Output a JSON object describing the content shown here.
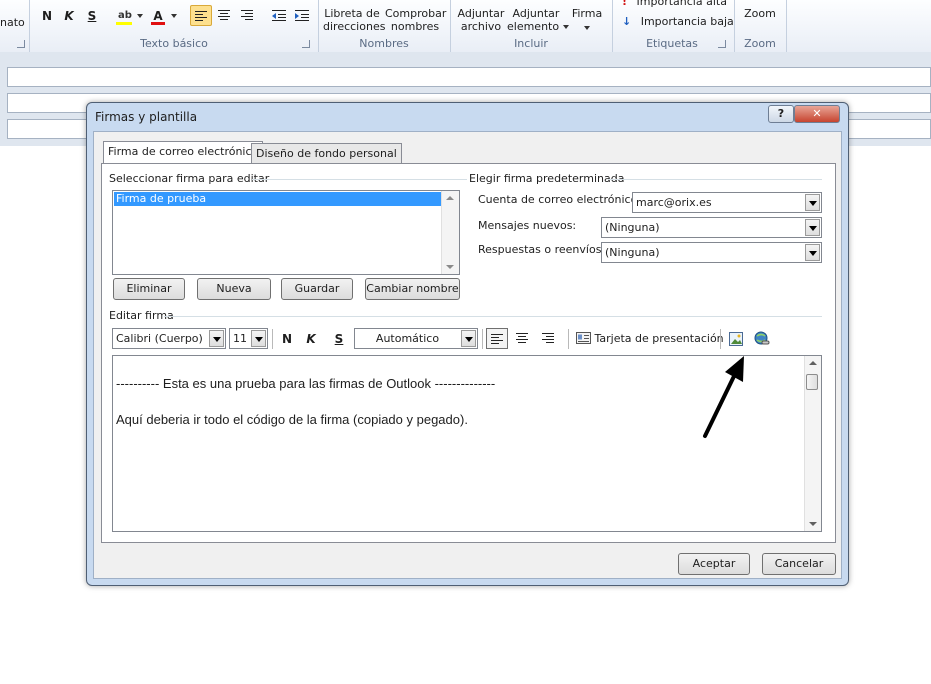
{
  "ribbon": {
    "formato_partial": "nato",
    "texto_basico": "Texto básico",
    "nombres_group": "Nombres",
    "incluir_group": "Incluir",
    "etiquetas_group": "Etiquetas",
    "zoom_group": "Zoom",
    "bold": "N",
    "italic": "K",
    "underline": "S",
    "highlight_glyph": "ab",
    "fontcolor_glyph": "A",
    "libreta_line1": "Libreta de",
    "libreta_line2": "direcciones",
    "comprobar_line1": "Comprobar",
    "comprobar_line2": "nombres",
    "adjuntar_archivo_line1": "Adjuntar",
    "adjuntar_archivo_line2": "archivo",
    "adjuntar_elemento_line1": "Adjuntar",
    "adjuntar_elemento_line2": "elemento",
    "firma": "Firma",
    "importancia_alta": "Importancia alta",
    "importancia_baja": "Importancia baja",
    "zoom": "Zoom"
  },
  "dialog": {
    "title": "Firmas y plantilla",
    "help_glyph": "?",
    "close_glyph": "✕",
    "tabs": [
      {
        "label": "Firma de correo electrónico"
      },
      {
        "label": "Diseño de fondo personal"
      }
    ],
    "select_section": "Seleccionar firma para editar",
    "signatures": [
      "Firma de prueba"
    ],
    "buttons": {
      "eliminar": "Eliminar",
      "nueva": "Nueva",
      "guardar": "Guardar",
      "cambiar_nombre": "Cambiar nombre"
    },
    "default_section": "Elegir firma predeterminada",
    "cuenta_label": "Cuenta de correo electrónico:",
    "cuenta_value": "marc@orix.es",
    "mensajes_label": "Mensajes nuevos:",
    "mensajes_value": "(Ninguna)",
    "respuestas_label": "Respuestas o reenvíos:",
    "respuestas_value": "(Ninguna)",
    "edit_section": "Editar firma",
    "font_value": "Calibri (Cuerpo)",
    "size_value": "11",
    "bold": "N",
    "italic": "K",
    "underline": "S",
    "color_value": "Automático",
    "tarjeta": "Tarjeta de presentación",
    "editor_lines": [
      "---------- Esta es una prueba para las firmas de Outlook --------------",
      "Aquí deberia ir todo el código de la firma (copiado y pegado)."
    ],
    "aceptar": "Aceptar",
    "cancelar": "Cancelar"
  }
}
